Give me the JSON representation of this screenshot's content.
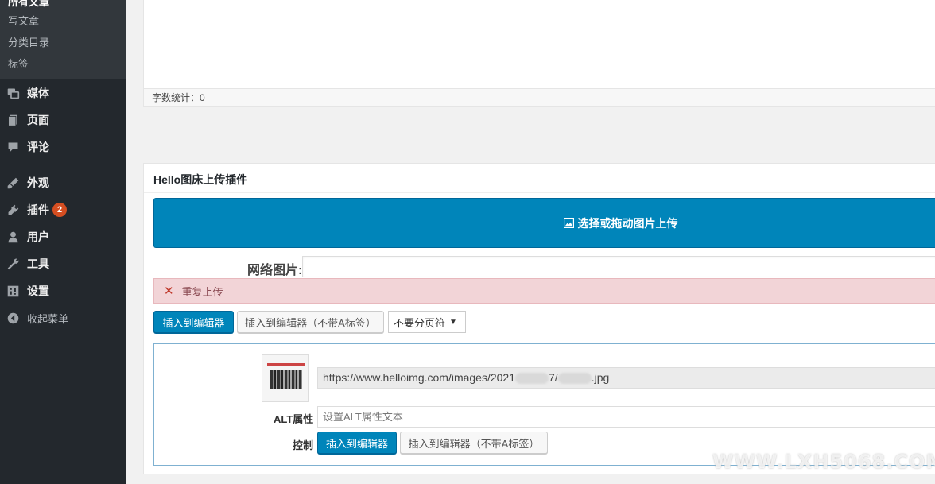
{
  "sidebar": {
    "cut_item": "所有文章",
    "sub_items": [
      "写文章",
      "分类目录",
      "标签"
    ],
    "menu": [
      {
        "label": "媒体",
        "icon": "media-icon"
      },
      {
        "label": "页面",
        "icon": "page-icon"
      },
      {
        "label": "评论",
        "icon": "comment-icon"
      },
      {
        "label": "外观",
        "icon": "appearance-icon"
      },
      {
        "label": "插件",
        "icon": "plugin-icon",
        "badge": "2"
      },
      {
        "label": "用户",
        "icon": "user-icon"
      },
      {
        "label": "工具",
        "icon": "wrench-icon"
      },
      {
        "label": "设置",
        "icon": "settings-icon"
      },
      {
        "label": "收起菜单",
        "icon": "collapse-icon"
      }
    ]
  },
  "editor": {
    "word_count": "字数统计：0"
  },
  "plugin": {
    "title": "Hello图床上传插件",
    "upload_label": "选择或拖动图片上传",
    "net_image_label": "网络图片:",
    "net_image_value": "",
    "error_text": "重复上传",
    "insert_button": "插入到编辑器",
    "insert_no_a_button": "插入到编辑器（不带A标签）",
    "page_break_select": "不要分页符",
    "result": {
      "url_prefix": "https://www.helloimg.com/images/2021",
      "url_mid": "7/",
      "url_suffix": ".jpg",
      "alt_label": "ALT属性",
      "alt_placeholder": "设置ALT属性文本",
      "control_label": "控制",
      "insert_button": "插入到编辑器",
      "insert_no_a_button": "插入到编辑器（不带A标签）"
    }
  },
  "watermark": "WWW.LXH5068.COM",
  "colors": {
    "sidebar_bg": "#23282d",
    "accent": "#0085ba",
    "error_bg": "#f2d4d7",
    "badge": "#d54e21"
  }
}
